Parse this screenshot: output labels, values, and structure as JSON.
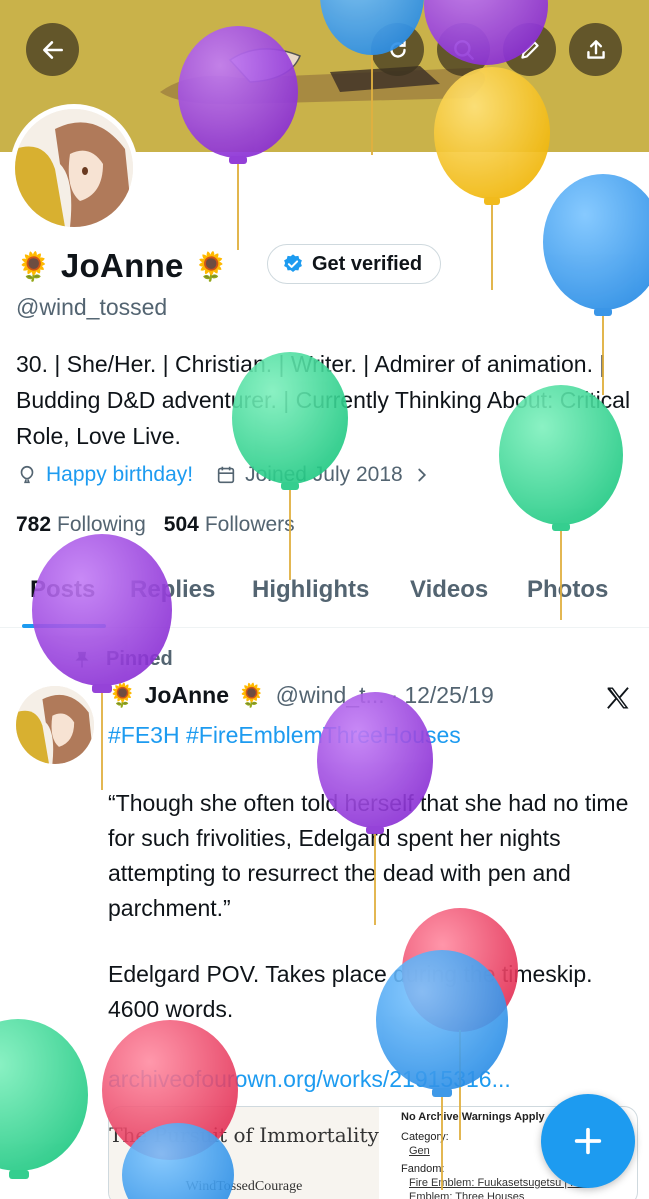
{
  "header": {
    "icons": [
      "back-arrow-icon",
      "refresh-icon",
      "search-icon",
      "edit-icon",
      "share-icon"
    ]
  },
  "profile": {
    "emoji_left": "🌻",
    "display_name": "JoAnne",
    "emoji_right": "🌻",
    "verify_label": "Get verified",
    "handle": "@wind_tossed",
    "bio": "30. | She/Her. | Christian. | Writer. | Admirer of animation. | Budding D&D adventurer. | Currently Thinking About: Critical Role, Love Live.",
    "birthday": "Happy birthday!",
    "joined": "Joined July 2018",
    "following_count": "782",
    "following_label": "Following",
    "followers_count": "504",
    "followers_label": "Followers"
  },
  "tabs": [
    "Posts",
    "Replies",
    "Highlights",
    "Videos",
    "Photos"
  ],
  "post": {
    "pinned_label": "Pinned",
    "author": "JoAnne",
    "emoji": "🌻",
    "handle": "@wind_t...",
    "dot": "·",
    "date": "12/25/19",
    "hashtags": "#FE3H #FireEmblemThreeHouses",
    "quote": "“Though she often told herself that she had no time for such frivolities, Edelgard spent her nights attempting to resurrect the dead with pen and parchment.”",
    "summary": "Edelgard POV. Takes place during the timeskip. 4600 words.",
    "link": "archiveofourown.org/works/21915316...",
    "card": {
      "title": "The Pursuit of Immortality",
      "author": "WindTossedCourage",
      "warning": "No Archive Warnings Apply",
      "category_label": "Category:",
      "category": "Gen",
      "fandom_label": "Fandom:",
      "fandom1": "Fire Emblem: Fuukasetsugetsu | Fire",
      "fandom2": "Emblem: Three Houses"
    }
  },
  "colors": {
    "accent": "#1d9bf0",
    "banner": "#c9b24a",
    "muted": "#536471",
    "balloon_purple": "#9b3fe0",
    "balloon_blue": "#3aa0f0",
    "balloon_green": "#2fd98f",
    "balloon_yellow": "#f5c21a",
    "balloon_red": "#ee3f62"
  }
}
